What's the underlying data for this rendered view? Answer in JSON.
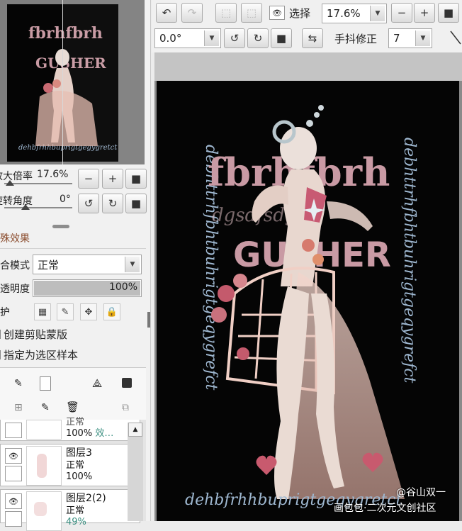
{
  "navigator": {
    "zoom_label": "放大倍率",
    "zoom_value": "17.6%",
    "angle_label": "旋转角度",
    "angle_value": "0°"
  },
  "panel": {
    "special_effects": "特殊效果",
    "blend_label": "混合模式",
    "blend_value": "正常",
    "opacity_label": "不透明度",
    "opacity_value": "100%",
    "opacity_level": 1.0,
    "protect_label": "保护",
    "clip_label": "创建剪贴蒙版",
    "sample_label": "指定为选区样本"
  },
  "layers": [
    {
      "name": "正常",
      "mode": "100%",
      "opacity": "效…",
      "partial": true
    },
    {
      "name": "图层3",
      "mode": "正常",
      "opacity": "100%"
    },
    {
      "name": "图层2(2)",
      "mode": "正常",
      "opacity": "49%"
    }
  ],
  "toolbar": {
    "select_label": "选择",
    "zoom_value": "17.6%",
    "angle_value": "0.0°",
    "stabilizer_label": "手抖修正",
    "stabilizer_value": "7"
  },
  "artwork": {
    "title_line1": "fbrhfbrh",
    "title_line2": "GUSHER",
    "script_top": "dgsdfsdgtht",
    "script_bottom": "dehbfrhhbuprigtgegygretct",
    "script_side": "debhttrhfbhtbuhrigtgeqygrefct"
  },
  "watermark": {
    "line1": "@谷山双一",
    "line2": "画包包·二次元文创社区"
  },
  "icons": [
    "undo-icon",
    "redo-icon",
    "eye-icon",
    "minus-icon",
    "plus-icon",
    "reset-icon",
    "rotate-left-icon",
    "rotate-right-icon",
    "flip-icon",
    "pen-icon",
    "move-icon",
    "lock-icon",
    "trash-icon"
  ]
}
